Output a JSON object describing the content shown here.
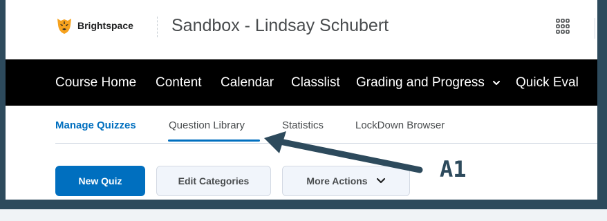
{
  "minibar": {
    "brand": "Brightspace",
    "course_title": "Sandbox - Lindsay Schubert"
  },
  "navbar": {
    "items": [
      {
        "label": "Course Home"
      },
      {
        "label": "Content"
      },
      {
        "label": "Calendar"
      },
      {
        "label": "Classlist"
      },
      {
        "label": "Grading and Progress"
      },
      {
        "label": "Quick Eval"
      }
    ]
  },
  "tabs": [
    {
      "label": "Manage Quizzes",
      "active": true
    },
    {
      "label": "Question Library"
    },
    {
      "label": "Statistics"
    },
    {
      "label": "LockDown Browser"
    }
  ],
  "actions": {
    "new_quiz": "New Quiz",
    "edit_categories": "Edit Categories",
    "more_actions": "More Actions"
  },
  "annotation": {
    "label": "A1"
  },
  "colors": {
    "frame": "#2d4a5c",
    "primary": "#006fbf",
    "navbar": "#000000"
  }
}
